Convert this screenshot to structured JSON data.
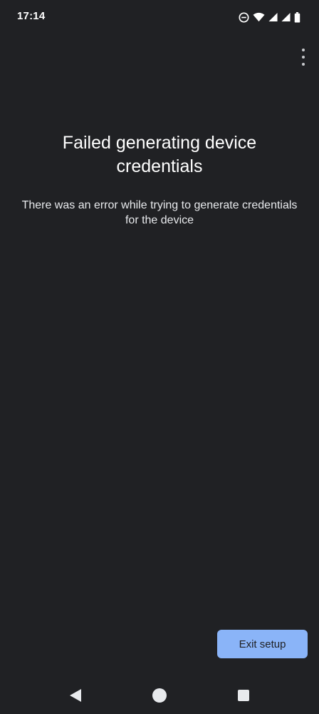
{
  "status_bar": {
    "time": "17:14",
    "icons": [
      "do-not-disturb-icon",
      "wifi-icon",
      "signal-icon",
      "signal-icon",
      "battery-icon"
    ]
  },
  "screen": {
    "title": "Failed generating device credentials",
    "description": "There was an error while trying to generate credentials for the device"
  },
  "actions": {
    "exit_label": "Exit setup"
  },
  "nav_bar": {
    "icons": [
      "back-icon",
      "home-icon",
      "recents-icon"
    ]
  },
  "colors": {
    "background": "#202124",
    "accent": "#8ab4f8",
    "text": "#ffffff"
  }
}
